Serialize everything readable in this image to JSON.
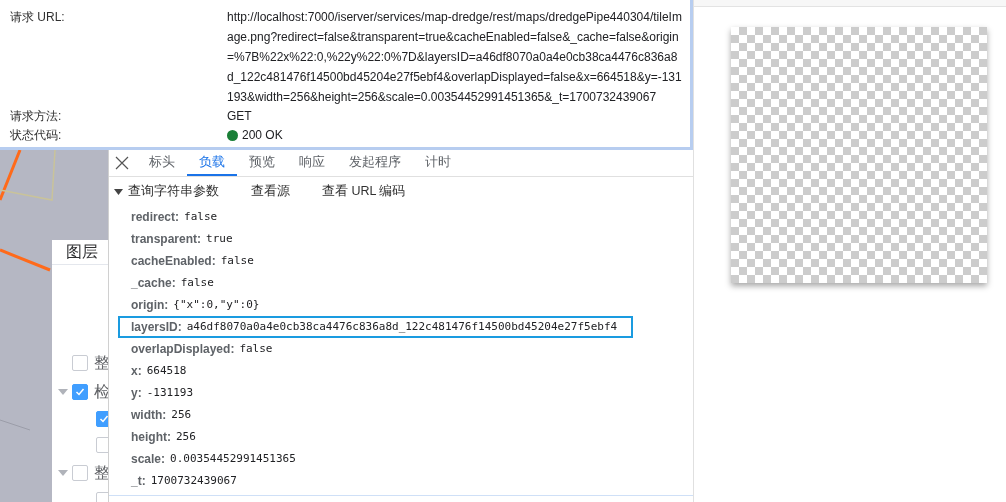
{
  "layer_panel": {
    "title": "图层",
    "items": [
      {
        "label": "整",
        "checked": false
      },
      {
        "label": "检",
        "checked": true,
        "expanded": true,
        "children": [
          {
            "checked": true
          },
          {
            "checked": false
          }
        ]
      },
      {
        "label": "整",
        "checked": false,
        "expanded": true,
        "children": [
          {
            "checked": false
          }
        ]
      }
    ]
  },
  "request_details": [
    {
      "label": "请求 URL:",
      "value": "http://localhost:7000/iserver/services/map-dredge/rest/maps/dredgePipe440304/tileImage.png?redirect=false&transparent=true&cacheEnabled=false&_cache=false&origin=%7B%22x%22:0,%22y%22:0%7D&layersID=a46df8070a0a4e0cb38ca4476c836a8d_122c481476f14500bd45204e27f5ebf4&overlapDisplayed=false&x=664518&y=-131193&width=256&height=256&scale=0.00354452991451365&_t=1700732439067"
    },
    {
      "label": "请求方法:",
      "value": "GET"
    },
    {
      "label": "状态代码:",
      "value": "200 OK",
      "color": "#1a7f37"
    }
  ],
  "tabs": [
    {
      "label": "标头",
      "selected": false
    },
    {
      "label": "负载",
      "selected": true
    },
    {
      "label": "预览",
      "selected": false
    },
    {
      "label": "响应",
      "selected": false
    },
    {
      "label": "发起程序",
      "selected": false
    },
    {
      "label": "计时",
      "selected": false
    }
  ],
  "section": {
    "title": "查询字符串参数",
    "expanded": true,
    "actions": [
      "查看源",
      "查看 URL 编码"
    ]
  },
  "params": [
    {
      "key": "redirect:",
      "value": "false",
      "selected": false
    },
    {
      "key": "transparent:",
      "value": "true",
      "selected": false
    },
    {
      "key": "cacheEnabled:",
      "value": "false",
      "selected": false
    },
    {
      "key": "_cache:",
      "value": "false",
      "selected": false
    },
    {
      "key": "origin:",
      "value": "{\"x\":0,\"y\":0}",
      "selected": false
    },
    {
      "key": "layersID:",
      "value": "a46df8070a0a4e0cb38ca4476c836a8d_122c481476f14500bd45204e27f5ebf4",
      "selected": true
    },
    {
      "key": "overlapDisplayed:",
      "value": "false",
      "selected": false
    },
    {
      "key": "x:",
      "value": "664518",
      "selected": false
    },
    {
      "key": "y:",
      "value": "-131193",
      "selected": false
    },
    {
      "key": "width:",
      "value": "256",
      "selected": false
    },
    {
      "key": "height:",
      "value": "256",
      "selected": false
    },
    {
      "key": "scale:",
      "value": "0.00354452991451365",
      "selected": false
    },
    {
      "key": "_t:",
      "value": "1700732439067",
      "selected": false
    }
  ],
  "preview": {
    "kind": "transparent-image"
  }
}
